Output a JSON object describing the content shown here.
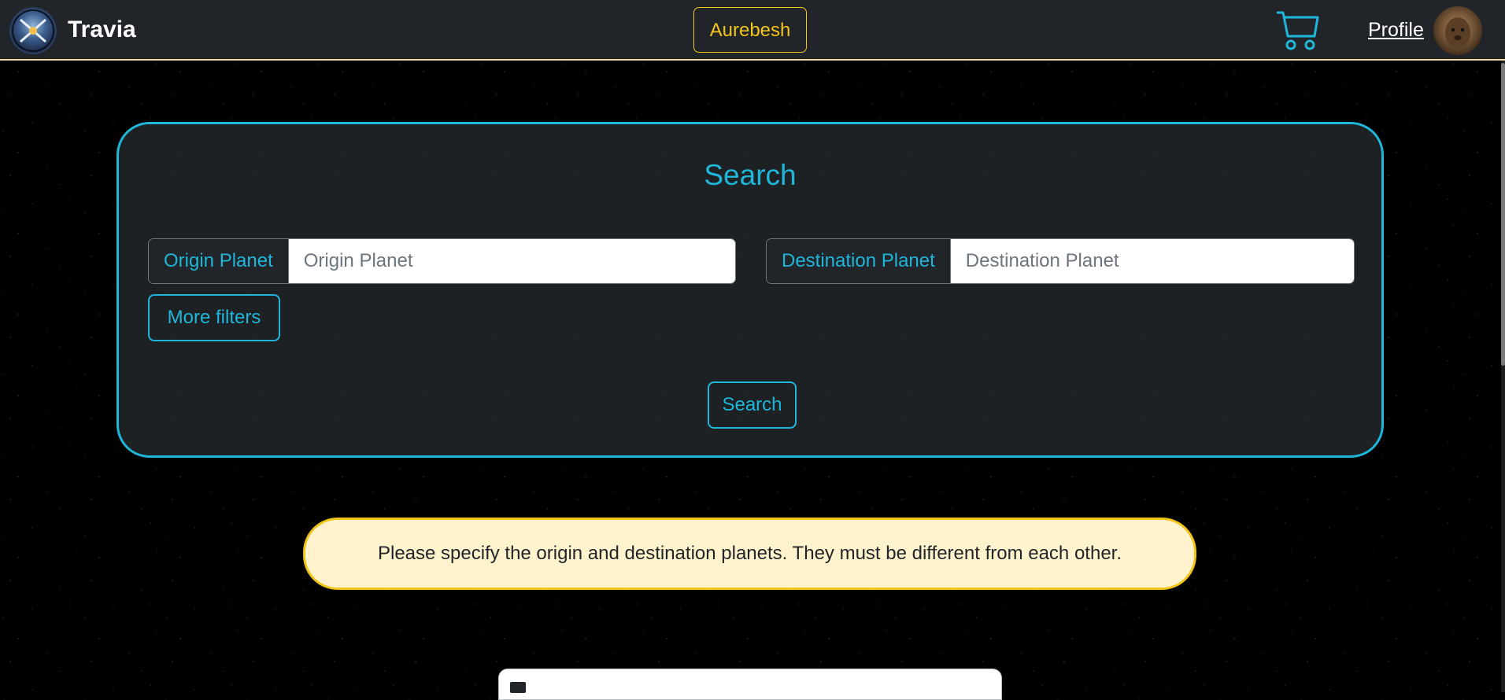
{
  "navbar": {
    "brand": "Travia",
    "aurebesh_label": "Aurebesh",
    "profile_label": "Profile",
    "cart_icon": "cart-icon",
    "accent": "#f0d9a0"
  },
  "search": {
    "title": "Search",
    "origin_label": "Origin Planet",
    "origin_placeholder": "Origin Planet",
    "origin_value": "",
    "destination_label": "Destination Planet",
    "destination_placeholder": "Destination Planet",
    "destination_value": "",
    "more_filters_label": "More filters",
    "submit_label": "Search",
    "accent": "#1fb6d9"
  },
  "alert": {
    "message": "Please specify the origin and destination planets. They must be different from each other.",
    "background": "#fff3cd",
    "border": "#f0c419"
  }
}
